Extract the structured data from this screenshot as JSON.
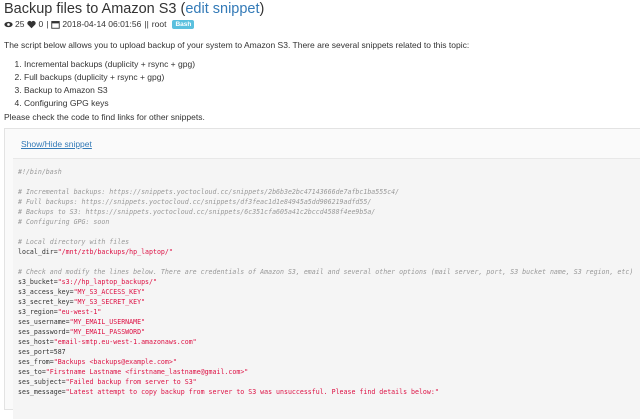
{
  "header": {
    "title": "Backup files to Amazon S3",
    "edit_link": "edit snippet",
    "views": "25",
    "likes": "0",
    "date": "2018-04-14 06:01:56",
    "author": "root",
    "tag": "Bash"
  },
  "intro": "The script below allows you to upload backup of your system to Amazon S3. There are several snippets related to this topic:",
  "topics": [
    "Incremental backups (duplicity + rsync + gpg)",
    "Full backups (duplicity + rsync + gpg)",
    "Backup to Amazon S3",
    "Configuring GPG keys"
  ],
  "check_text": "Please check the code to find links for other snippets.",
  "toggle_label": "Show/Hide snippet",
  "code": {
    "shebang": "#!/bin/bash",
    "c1": "# Incremental backups: https://snippets.yoctocloud.cc/snippets/2b6b3e2bc47143666de7afbc1ba555c4/",
    "c2": "# Full backups: https://snippets.yoctocloud.cc/snippets/df3feac1d1e84945a5dd906219adfd55/",
    "c3": "# Backups to S3: https://snippets.yoctocloud.cc/snippets/6c351cfa605a41c2bccd4588f4ee9b5a/",
    "c4": "# Configuring GPG: soon",
    "c5": "# Local directory with files",
    "local_dir_key": "local_dir=",
    "local_dir_val": "\"/mnt/ztb/backups/hp_laptop/\"",
    "c6": "# Check and modify the lines below. There are credentials of Amazon S3, email and several other options (mail server, port, S3 bucket name, S3 region, etc)",
    "vars": [
      {
        "k": "s3_bucket=",
        "v": "\"s3://hp_laptop_backups/\""
      },
      {
        "k": "s3_access_key=",
        "v": "\"MY_S3_ACCESS_KEY\""
      },
      {
        "k": "s3_secret_key=",
        "v": "\"MY_S3_SECRET_KEY\""
      },
      {
        "k": "s3_region=",
        "v": "\"eu-west-1\""
      },
      {
        "k": "ses_username=",
        "v": "\"MY_EMAIL_USERNAME\""
      },
      {
        "k": "ses_password=",
        "v": "\"MY_EMAIL_PASSWORD\""
      },
      {
        "k": "ses_host=",
        "v": "\"email-smtp.eu-west-1.amazonaws.com\""
      },
      {
        "k": "ses_port=",
        "v": "587"
      },
      {
        "k": "ses_from=",
        "v": "\"Backups <backups@example.com>\""
      },
      {
        "k": "ses_to=",
        "v": "\"Firstname Lastname <firstname_lastname@gmail.com>\""
      },
      {
        "k": "ses_subject=",
        "v": "\"Failed backup from server to S3\""
      },
      {
        "k": "ses_message=",
        "v": "\"Latest attempt to copy backup from server to S3 was unsuccessful. Please find details below:\""
      }
    ]
  }
}
